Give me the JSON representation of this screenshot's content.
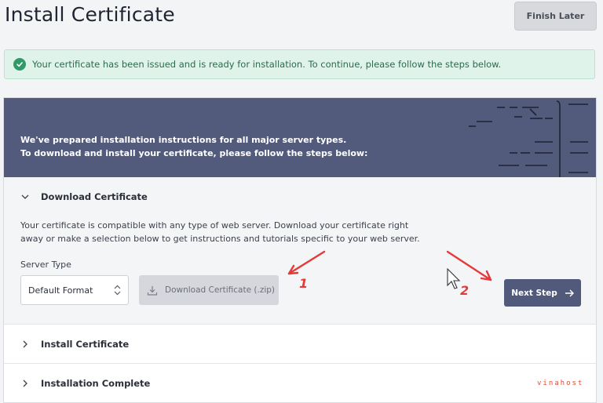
{
  "header": {
    "title": "Install Certificate",
    "finish_label": "Finish Later"
  },
  "alert": {
    "message": "Your certificate has been issued and is ready for installation. To continue, please follow the steps below."
  },
  "banner": {
    "line1": "We've prepared installation instructions for all major server types.",
    "line2": "To download and install your certificate, please follow the steps below:"
  },
  "steps": [
    {
      "label": "Download Certificate",
      "expanded": true
    },
    {
      "label": "Install Certificate",
      "expanded": false
    },
    {
      "label": "Installation Complete",
      "expanded": false
    }
  ],
  "download": {
    "description_line1": "Your certificate is compatible with any type of web server. Download your certificate right",
    "description_line2": "away or make a selection below to get instructions and tutorials specific to your web server.",
    "server_type_label": "Server Type",
    "server_type_value": "Default Format",
    "download_button": "Download Certificate (.zip)",
    "next_button": "Next Step"
  },
  "annotations": {
    "marker1": "1",
    "marker2": "2",
    "color": "#e43a3a"
  },
  "watermark": "vinahost",
  "colors": {
    "banner": "#535b7d",
    "next_button": "#525a7c",
    "alert_bg": "#dff3ea",
    "alert_icon": "#2f9a69"
  },
  "icons": [
    "check-circle-icon",
    "chevron-down-icon",
    "chevron-right-icon",
    "updown-icon",
    "download-icon",
    "arrow-right-icon",
    "mouse-cursor-icon"
  ]
}
